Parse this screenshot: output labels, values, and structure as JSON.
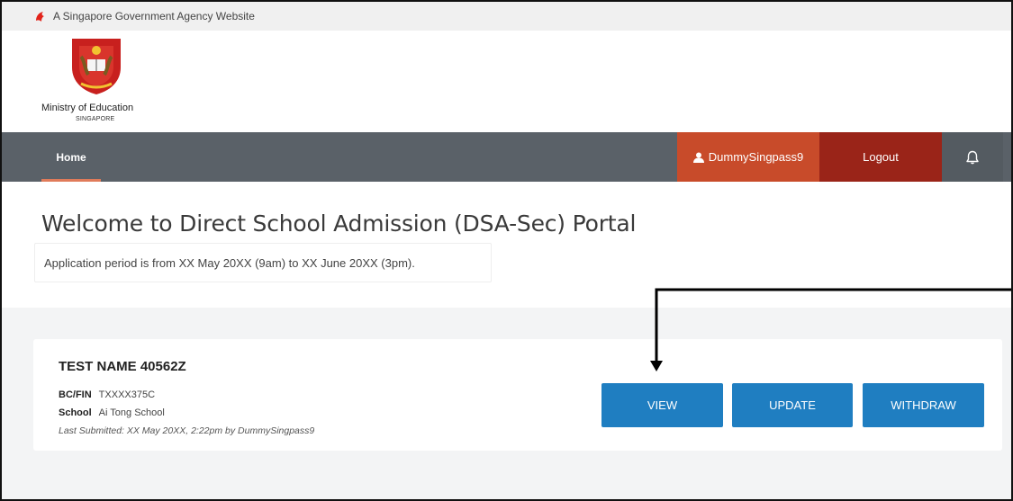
{
  "gov_banner": {
    "text": "A Singapore Government Agency Website",
    "icon": "lion-head-icon"
  },
  "agency": {
    "name": "Ministry of Education",
    "country": "SINGAPORE",
    "logo": "moe-crest-icon"
  },
  "nav": {
    "home_label": "Home",
    "user_name": "DummySingpass9",
    "user_icon": "user-icon",
    "logout_label": "Logout",
    "notification_icon": "bell-icon"
  },
  "welcome": {
    "title": "Welcome to Direct School Admission (DSA-Sec) Portal",
    "period": "Application period is from XX May 20XX (9am) to XX June 20XX (3pm)."
  },
  "application": {
    "name": "TEST NAME 40562Z",
    "id_label": "BC/FIN",
    "id_value": "TXXXX375C",
    "school_label": "School",
    "school_value": "Ai Tong School",
    "last_submitted_text": "Last Submitted: XX May 20XX, 2:22pm",
    "by_text": "by DummySingpass9",
    "buttons": {
      "view": "VIEW",
      "update": "UPDATE",
      "withdraw": "WITHDRAW"
    }
  },
  "colors": {
    "nav_bg": "#5a6168",
    "user_bg": "#c84b2a",
    "logout_bg": "#9a2418",
    "primary_button": "#1f7ec1",
    "home_underline": "#e07b5a"
  }
}
